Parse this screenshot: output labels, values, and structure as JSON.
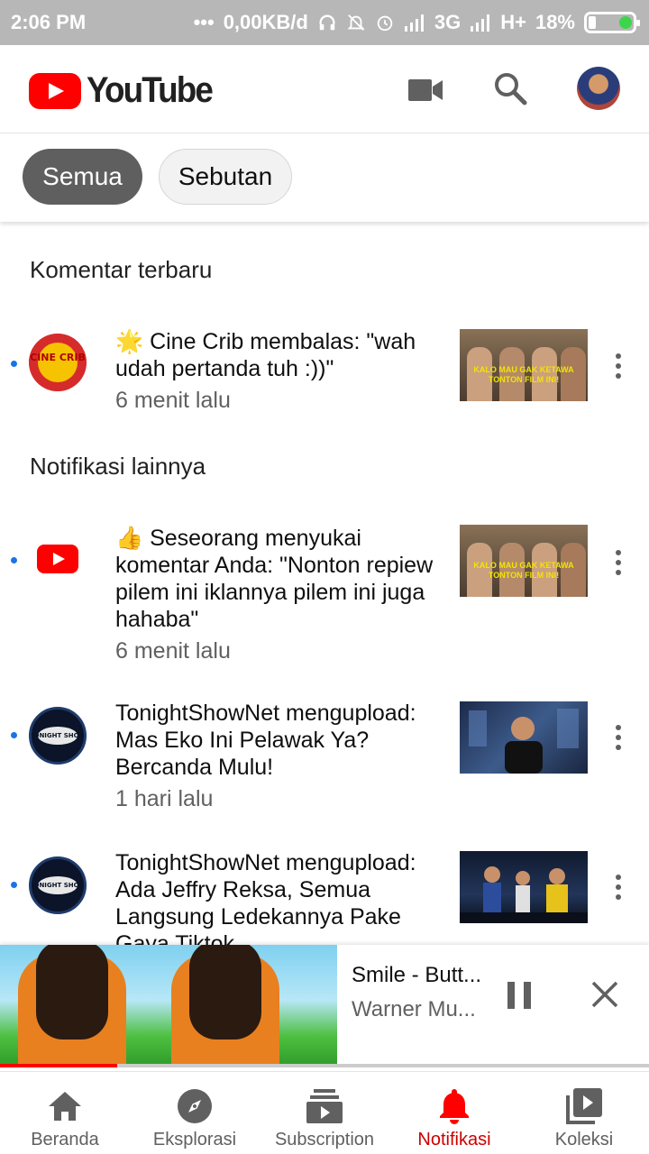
{
  "status_bar": {
    "time": "2:06 PM",
    "dots": "•••",
    "data_rate": "0,00KB/d",
    "network1": "3G",
    "network2": "H+",
    "battery": "18%"
  },
  "header": {
    "logo_text": "YouTube",
    "icons": [
      "video-camera-icon",
      "search-icon",
      "account-avatar"
    ]
  },
  "filters": {
    "chips": [
      {
        "label": "Semua",
        "selected": true
      },
      {
        "label": "Sebutan",
        "selected": false
      }
    ]
  },
  "sections": {
    "recent_title": "Komentar terbaru",
    "other_title": "Notifikasi lainnya"
  },
  "notifications": [
    {
      "text": "🌟 Cine Crib membalas: \"wah udah pertanda tuh :))\"",
      "time": "6 menit lalu",
      "channel_logo_text": "CINE CRIB",
      "thumb_caption": "KALO MAU GAK KETAWA TONTON FILM INI!"
    },
    {
      "text": "👍 Seseorang menyukai komentar Anda: \"Nonton repiew pilem ini iklannya pilem ini juga hahaba\"",
      "time": "6 menit lalu",
      "thumb_caption": "KALO MAU GAK KETAWA TONTON FILM INI!"
    },
    {
      "text": "TonightShowNet mengupload: Mas Eko Ini Pelawak Ya? Bercanda Mulu!",
      "time": "1 hari lalu",
      "channel_logo_text": "TONIGHT SHOW"
    },
    {
      "text": "TonightShowNet mengupload: Ada Jeffry Reksa, Semua Langsung Ledekannya Pake Gaya Tiktok",
      "time": "",
      "channel_logo_text": "TONIGHT SHOW"
    }
  ],
  "mini_player": {
    "title": "Smile - Butt...",
    "channel": "Warner Mu...",
    "progress": 0.18
  },
  "bottom_nav": [
    {
      "label": "Beranda",
      "icon": "home-icon"
    },
    {
      "label": "Eksplorasi",
      "icon": "explore-compass-icon"
    },
    {
      "label": "Subscription",
      "icon": "subscriptions-icon"
    },
    {
      "label": "Notifikasi",
      "icon": "bell-icon",
      "active": true
    },
    {
      "label": "Koleksi",
      "icon": "library-icon"
    }
  ],
  "colors": {
    "accent_red": "#ff0000",
    "active_nav": "#cc0000",
    "unread_dot": "#1a73e8"
  }
}
